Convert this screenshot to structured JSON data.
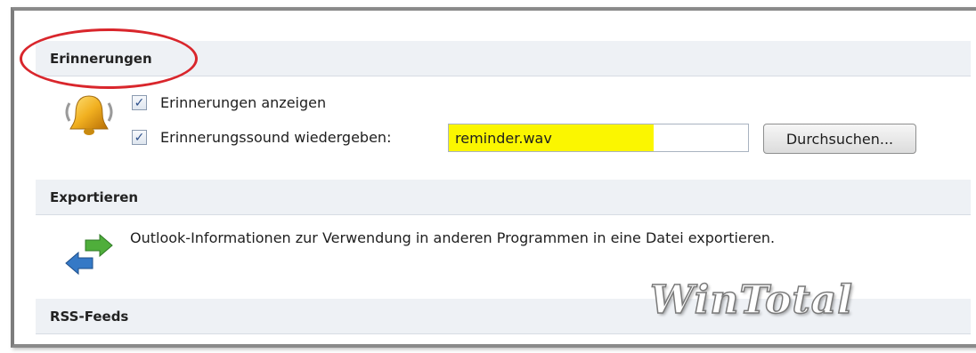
{
  "sections": {
    "reminders": {
      "title": "Erinnerungen",
      "show_reminders": {
        "label": "Erinnerungen anzeigen",
        "checked": true
      },
      "play_sound": {
        "label": "Erinnerungssound wiedergeben:",
        "checked": true,
        "value": "reminder.wav"
      },
      "browse_label": "Durchsuchen..."
    },
    "export": {
      "title": "Exportieren",
      "description": "Outlook-Informationen zur Verwendung in anderen Programmen in eine Datei exportieren."
    },
    "rss": {
      "title": "RSS-Feeds"
    }
  },
  "annotations": {
    "highlight_color": "#fbf600",
    "circle_color": "#d9262c"
  },
  "watermark": "WinTotal",
  "icons": {
    "reminders": "alarm-bell-icon",
    "export": "import-export-arrows-icon",
    "checkbox": "checkmark-icon"
  }
}
